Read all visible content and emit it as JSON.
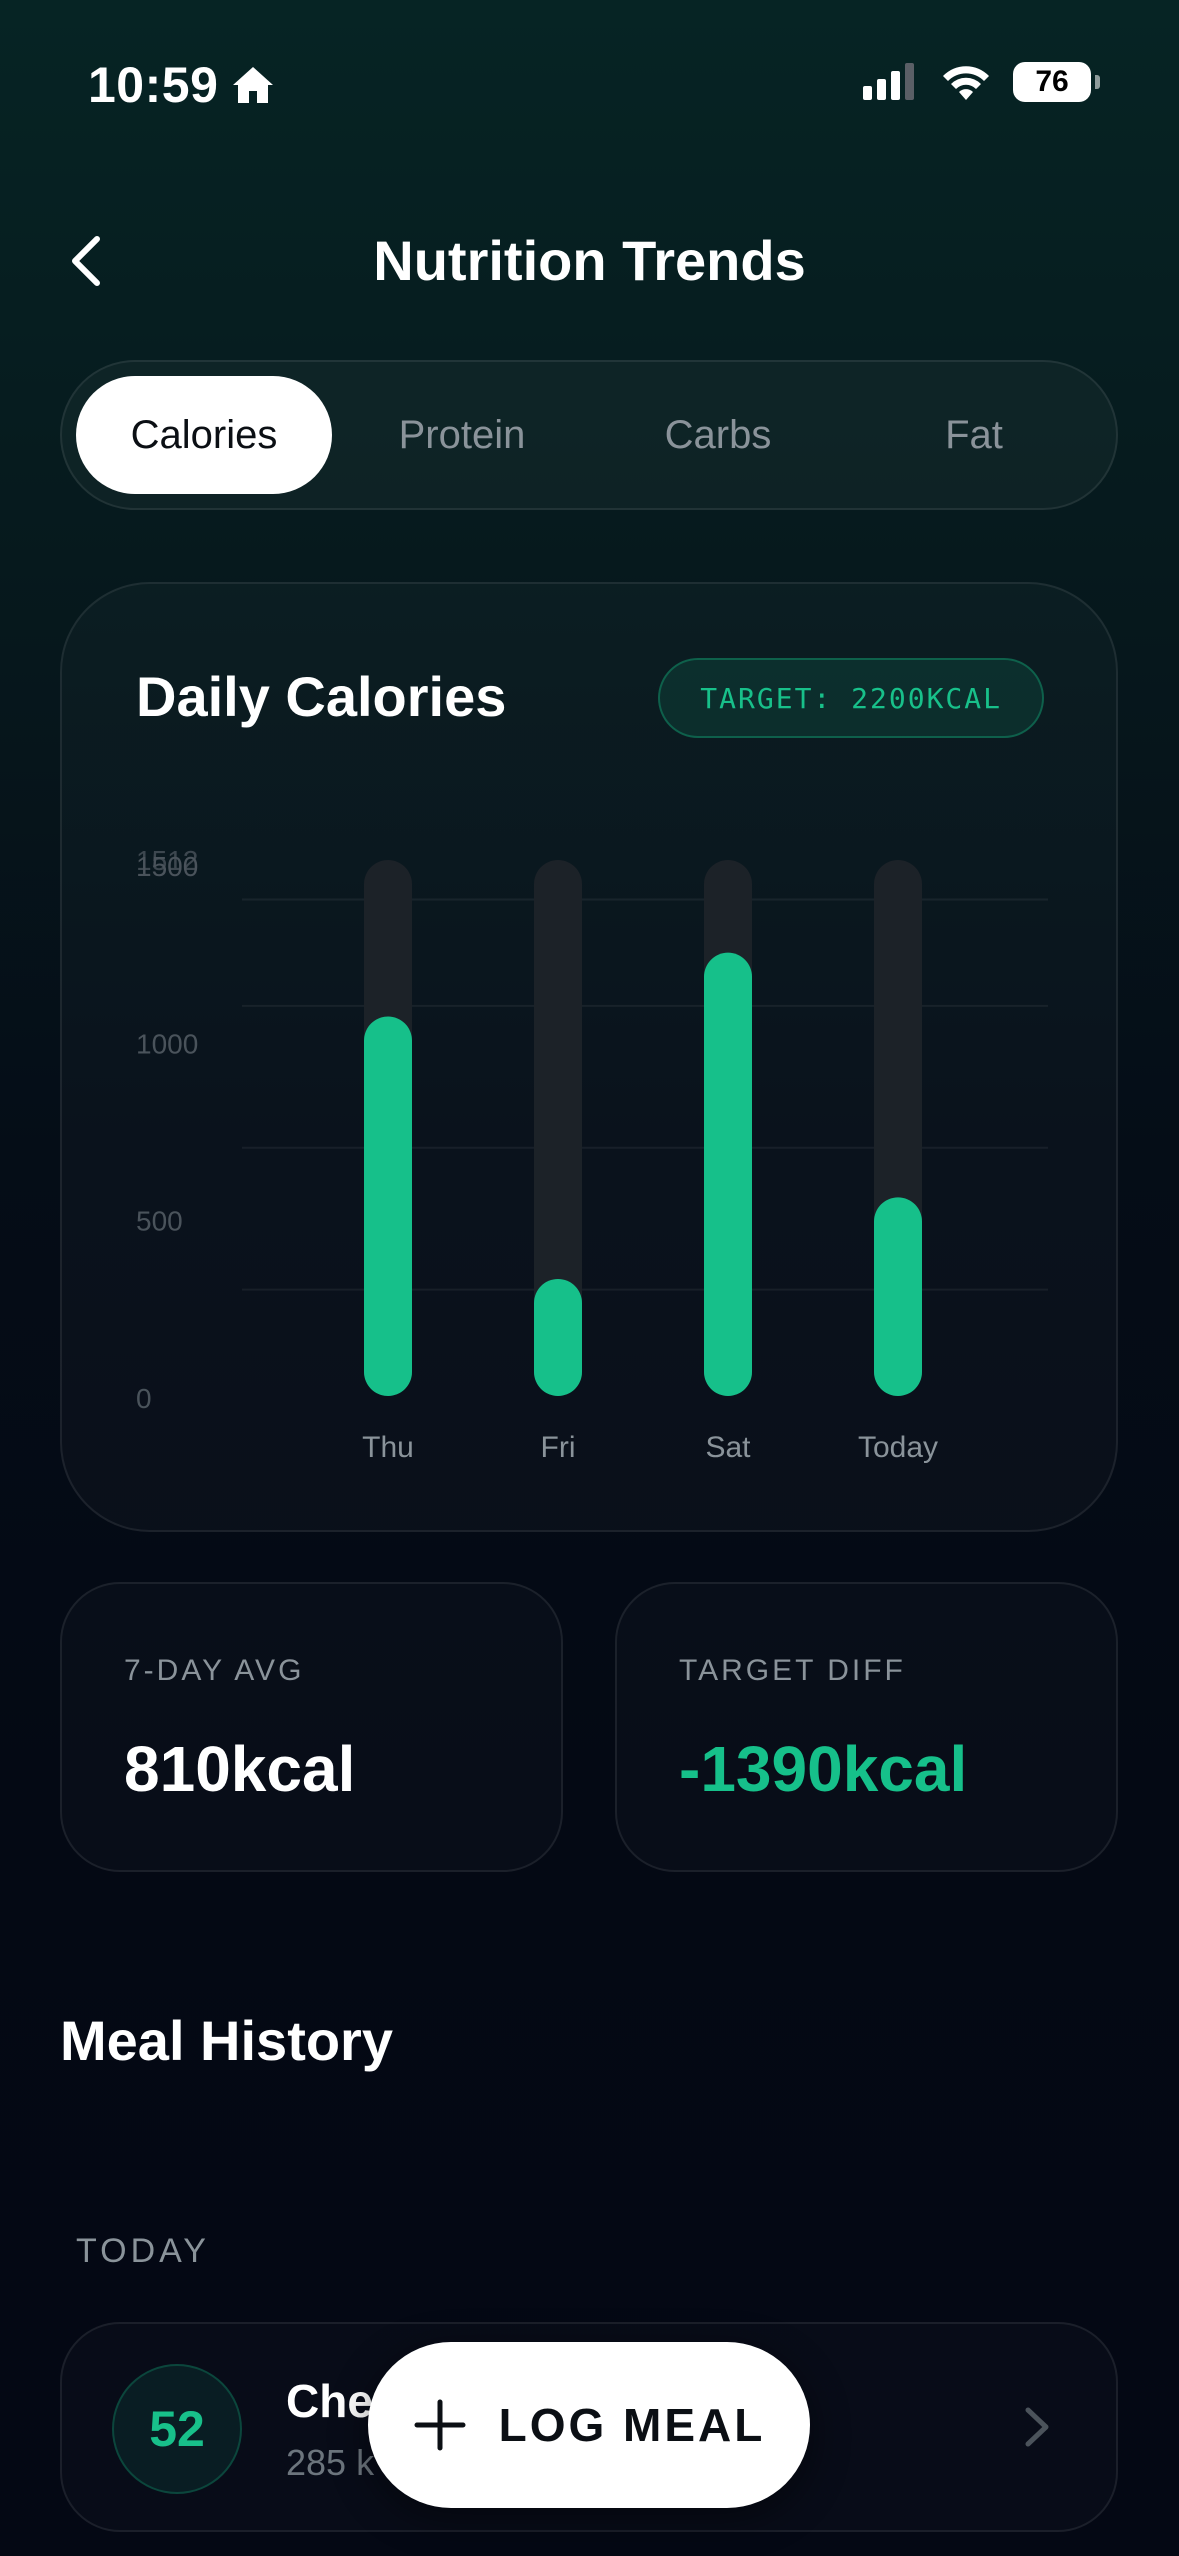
{
  "status_bar": {
    "time": "10:59",
    "battery": "76"
  },
  "header": {
    "title": "Nutrition Trends"
  },
  "tabs": [
    {
      "label": "Calories",
      "active": true
    },
    {
      "label": "Protein",
      "active": false
    },
    {
      "label": "Carbs",
      "active": false
    },
    {
      "label": "Fat",
      "active": false
    }
  ],
  "chart_card": {
    "title": "Daily Calories",
    "target_badge": "TARGET: 2200KCAL"
  },
  "chart_data": {
    "type": "bar",
    "categories": [
      "Thu",
      "Fri",
      "Sat",
      "Today"
    ],
    "values": [
      1070,
      330,
      1250,
      560
    ],
    "ylim": [
      0,
      1500
    ],
    "yticks": [
      0,
      500,
      1000,
      1500
    ],
    "ytick_labels": [
      "0",
      "500",
      "1000",
      "1500"
    ],
    "overlap_tick_label": "1512",
    "bar_color": "#16c08a",
    "track_color": "#1c2228",
    "grid": true
  },
  "stats": {
    "avg": {
      "label": "7-DAY AVG",
      "value": "810kcal"
    },
    "diff": {
      "label": "TARGET DIFF",
      "value": "-1390kcal"
    }
  },
  "meal_history": {
    "title": "Meal History",
    "group_label": "TODAY",
    "items": [
      {
        "score": "52",
        "name": "Che",
        "kcal": "285 k"
      }
    ]
  },
  "fab": {
    "label": "LOG MEAL"
  },
  "colors": {
    "accent": "#16c08a",
    "background": "#040914"
  }
}
